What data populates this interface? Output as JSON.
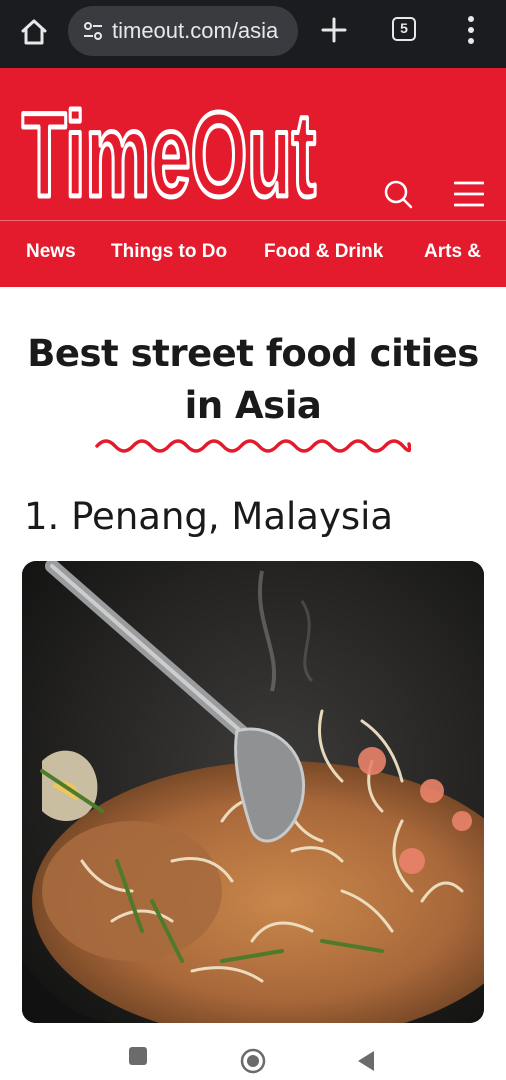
{
  "browser": {
    "url": "timeout.com/asia",
    "tab_count": "5"
  },
  "site": {
    "logo_text": "Time Out",
    "brand_color": "#e31b2c",
    "nav": [
      "News",
      "Things to Do",
      "Food & Drink",
      "Arts &"
    ]
  },
  "article": {
    "title_line1": "Best street food cities",
    "title_line2": "in Asia",
    "section_heading": "1. Penang, Malaysia",
    "image_subject": "char kway teow noodles frying in a wok with a metal spatula"
  },
  "icons": {
    "home": "home-icon",
    "site_settings": "tune-icon",
    "new_tab": "plus-icon",
    "tabs": "tab-switcher-icon",
    "menu": "more-vert-icon",
    "search": "search-icon",
    "hamburger": "hamburger-menu-icon",
    "recents": "recents-icon",
    "home_nav": "home-nav-icon",
    "back": "back-icon"
  }
}
